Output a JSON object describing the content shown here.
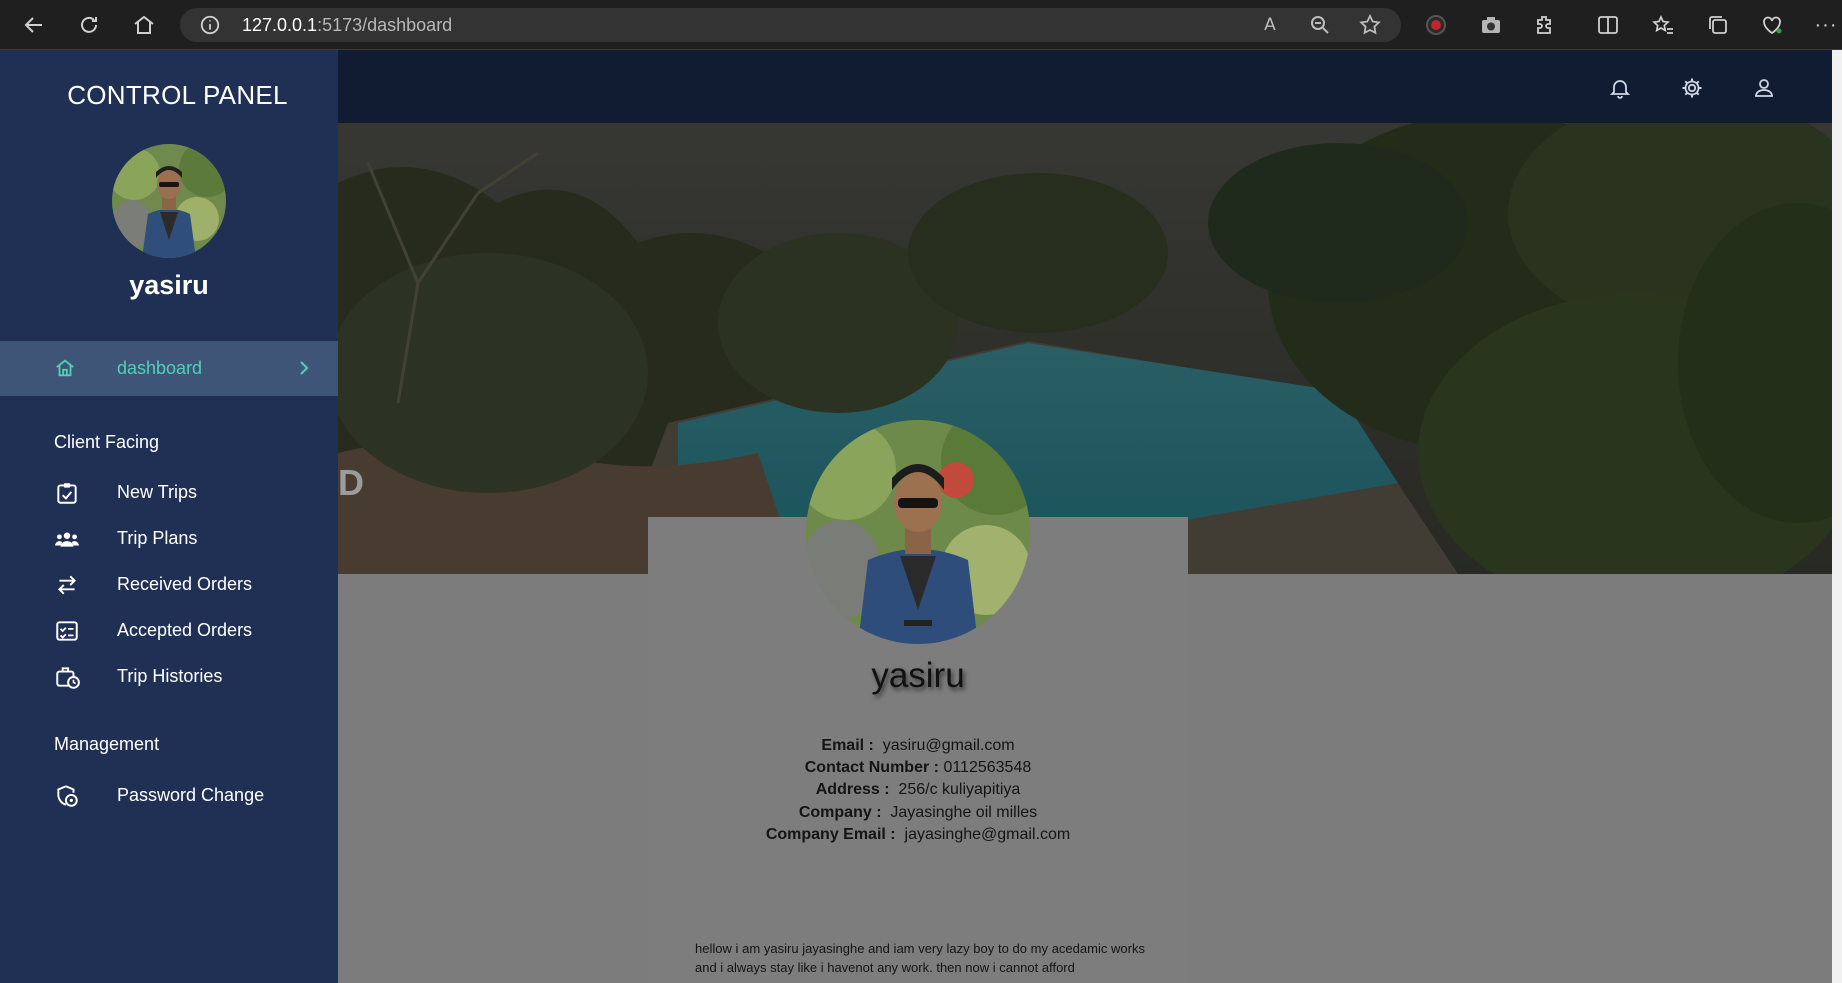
{
  "browser": {
    "url_host": "127.0.0.1",
    "url_path": ":5173/dashboard"
  },
  "sidebar": {
    "panel_title": "CONTROL PANEL",
    "user_name": "yasiru",
    "active_item": "dashboard",
    "sections": [
      {
        "title": "Client Facing",
        "items": [
          {
            "label": "New Trips",
            "icon": "clipboard-check-icon"
          },
          {
            "label": "Trip Plans",
            "icon": "users-icon"
          },
          {
            "label": "Received Orders",
            "icon": "swap-arrows-icon"
          },
          {
            "label": "Accepted Orders",
            "icon": "checklist-icon"
          },
          {
            "label": "Trip Histories",
            "icon": "briefcase-clock-icon"
          }
        ]
      },
      {
        "title": "Management",
        "items": [
          {
            "label": "Password Change",
            "icon": "shield-lock-icon"
          }
        ]
      }
    ]
  },
  "hero": {
    "partial_text": "D"
  },
  "profile": {
    "name": "yasiru",
    "fields": [
      {
        "label": "Email :",
        "value": "yasiru@gmail.com"
      },
      {
        "label": "Contact Number :",
        "value": "0112563548"
      },
      {
        "label": "Address :",
        "value": "256/c kuliyapitiya"
      },
      {
        "label": "Company :",
        "value": "Jayasinghe oil milles"
      },
      {
        "label": "Company Email :",
        "value": "jayasinghe@gmail.com"
      }
    ],
    "bio": "hellow i am yasiru jayasinghe and iam very lazy boy to do my acedamic works and i always stay like i havenot any work. then now i cannot afford"
  },
  "colors": {
    "sidebar_bg": "#203055",
    "active_accent": "#4fd1b5",
    "topbar_bg": "#111b31"
  }
}
